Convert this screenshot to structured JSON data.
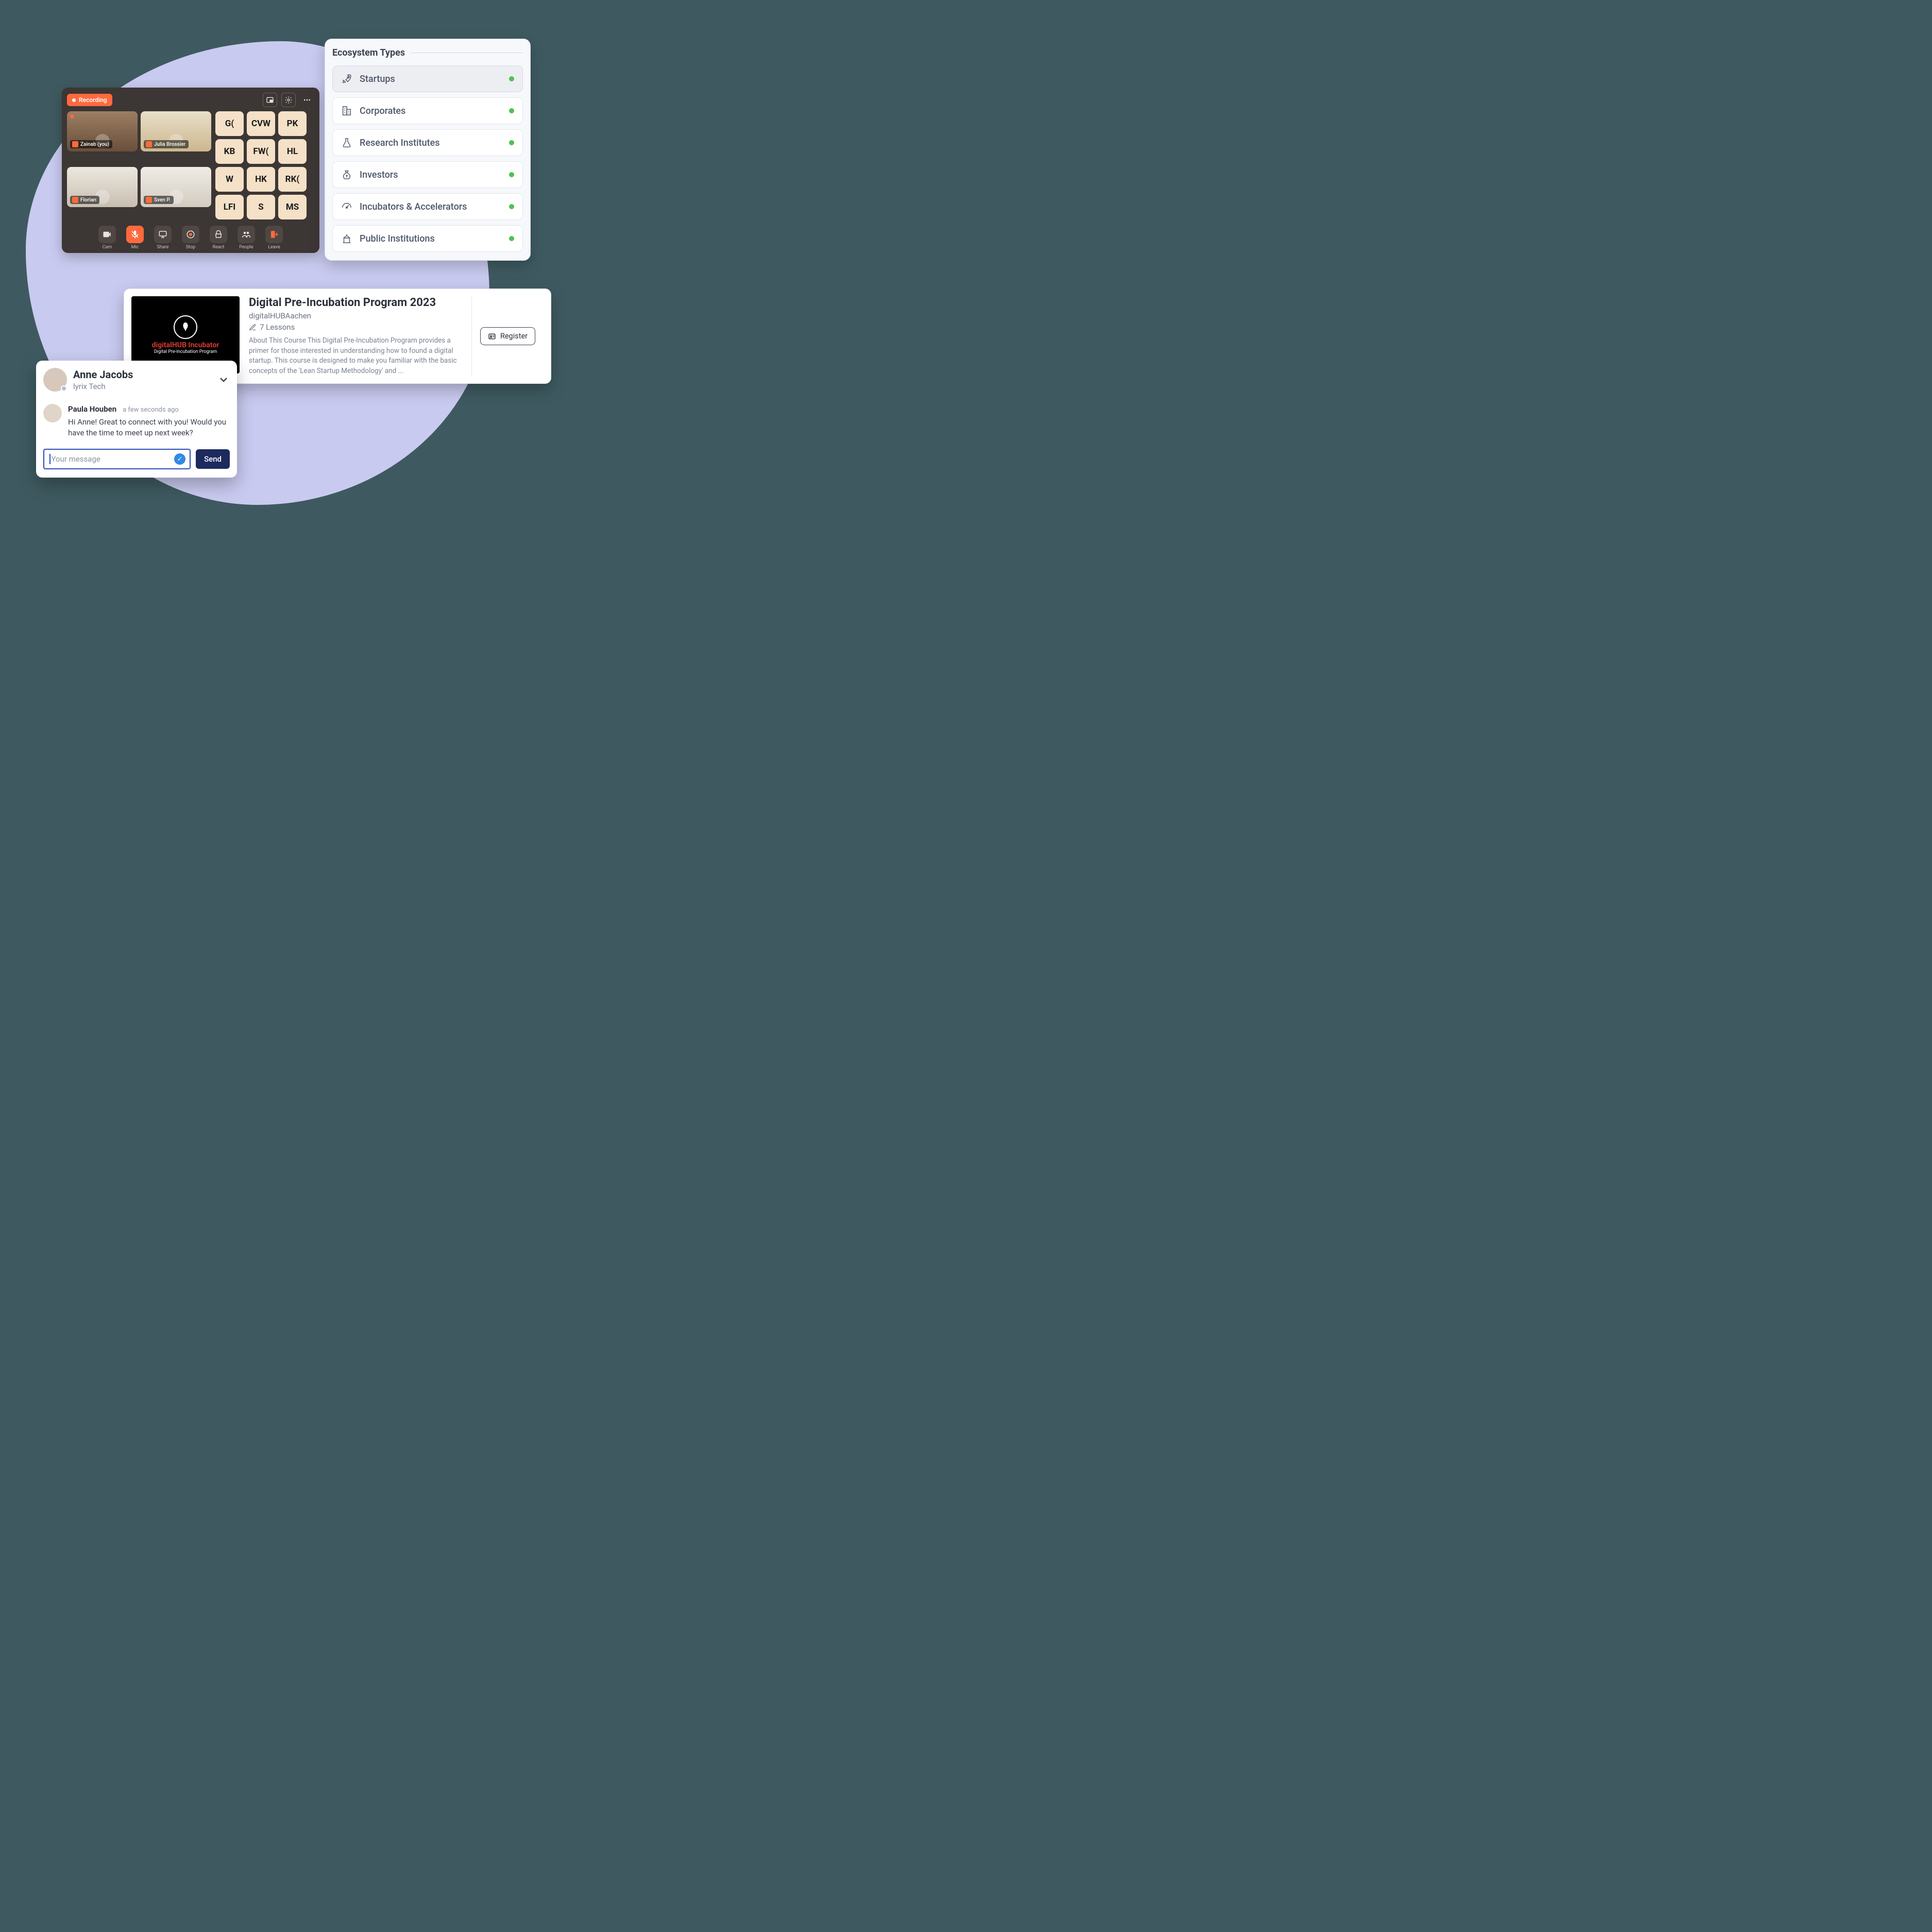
{
  "video": {
    "recording_label": "Recording",
    "participants": [
      {
        "name": "Zainab (you)",
        "owner": true
      },
      {
        "name": "Julia Brossier",
        "owner": false
      },
      {
        "name": "Florian",
        "owner": false
      },
      {
        "name": "Sven P.",
        "owner": false
      }
    ],
    "initials": [
      "G(",
      "CVW",
      "PK",
      "KB",
      "FW(",
      "HL",
      "W",
      "HK",
      "RK(",
      "LFI",
      "S",
      "MS"
    ],
    "controls": {
      "cam": "Cam",
      "mic": "Mic",
      "share": "Share",
      "stop": "Stop",
      "react": "React",
      "people": "People",
      "leave": "Leave"
    }
  },
  "ecosystem": {
    "title": "Ecosystem Types",
    "items": [
      {
        "label": "Startups",
        "selected": true
      },
      {
        "label": "Corporates",
        "selected": false
      },
      {
        "label": "Research Institutes",
        "selected": false
      },
      {
        "label": "Investors",
        "selected": false
      },
      {
        "label": "Incubators & Accelerators",
        "selected": false
      },
      {
        "label": "Public Institutions",
        "selected": false
      }
    ]
  },
  "course": {
    "title": "Digital Pre-Incubation Program 2023",
    "org": "digitalHUBAachen",
    "lessons": "7 Lessons",
    "description": "About This Course This Digital Pre-Incubation Program provides a primer for those interested in understanding how to found a digital startup. This course is designed to make you familiar with the basic concepts of the 'Lean Startup Methodology' and ...",
    "thumb_title": "digitalHUB Incubator",
    "thumb_sub": "Digital Pre-Incubation Program",
    "register": "Register"
  },
  "chat": {
    "name": "Anne Jacobs",
    "org": "lyrix Tech",
    "msg_name": "Paula Houben",
    "msg_time": "a few seconds ago",
    "msg_body": "Hi Anne! Great to connect with you! Would you have the time to meet up next week?",
    "placeholder": "Your message",
    "send": "Send"
  }
}
